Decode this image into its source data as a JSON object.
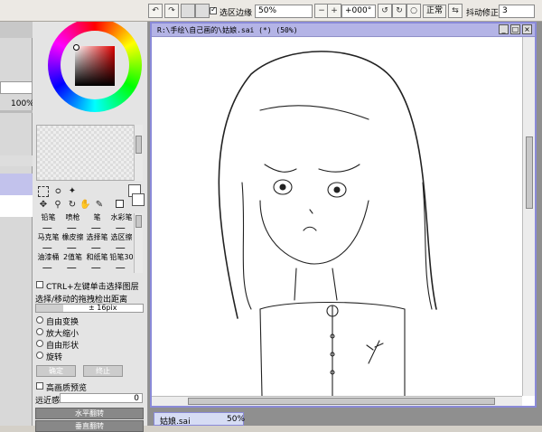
{
  "toolbar": {
    "selection_edge_label": "选区边缘",
    "zoom": "50%",
    "rotation": "+000°",
    "mode": "正常",
    "stabilizer_label": "抖动修正",
    "stabilizer_value": "3"
  },
  "strip": {
    "percent": "100%"
  },
  "tools": {
    "brushes": [
      "铅笔",
      "喷枪",
      "笔",
      "水彩笔",
      "马克笔",
      "橡皮擦",
      "选择笔",
      "选区擦",
      "油漆桶",
      "2值笔",
      "和纸笔",
      "铅笔30"
    ],
    "ctrl_label": "CTRL+左键单击选择图层",
    "move_label": "选择/移动的拖拽检出距离",
    "move_value": "± 16pix",
    "transform_options": [
      "自由变换",
      "放大缩小",
      "自由形状",
      "旋转"
    ],
    "confirm_label": "确定",
    "cancel_label": "终止",
    "hq_preview_label": "高画质预览",
    "near_label": "远近感",
    "near_value": "0",
    "flip_h_label": "水平翻转",
    "flip_v_label": "垂直翻转"
  },
  "document": {
    "title": "R:\\手绘\\自己画的\\姑娘.sai (*) (50%)",
    "tab_name": "姑娘.sai",
    "tab_zoom": "50%"
  },
  "colors": {
    "accent": "#b4b4e6",
    "panel": "#e4e4e4",
    "workspace": "#8f8f8f"
  }
}
